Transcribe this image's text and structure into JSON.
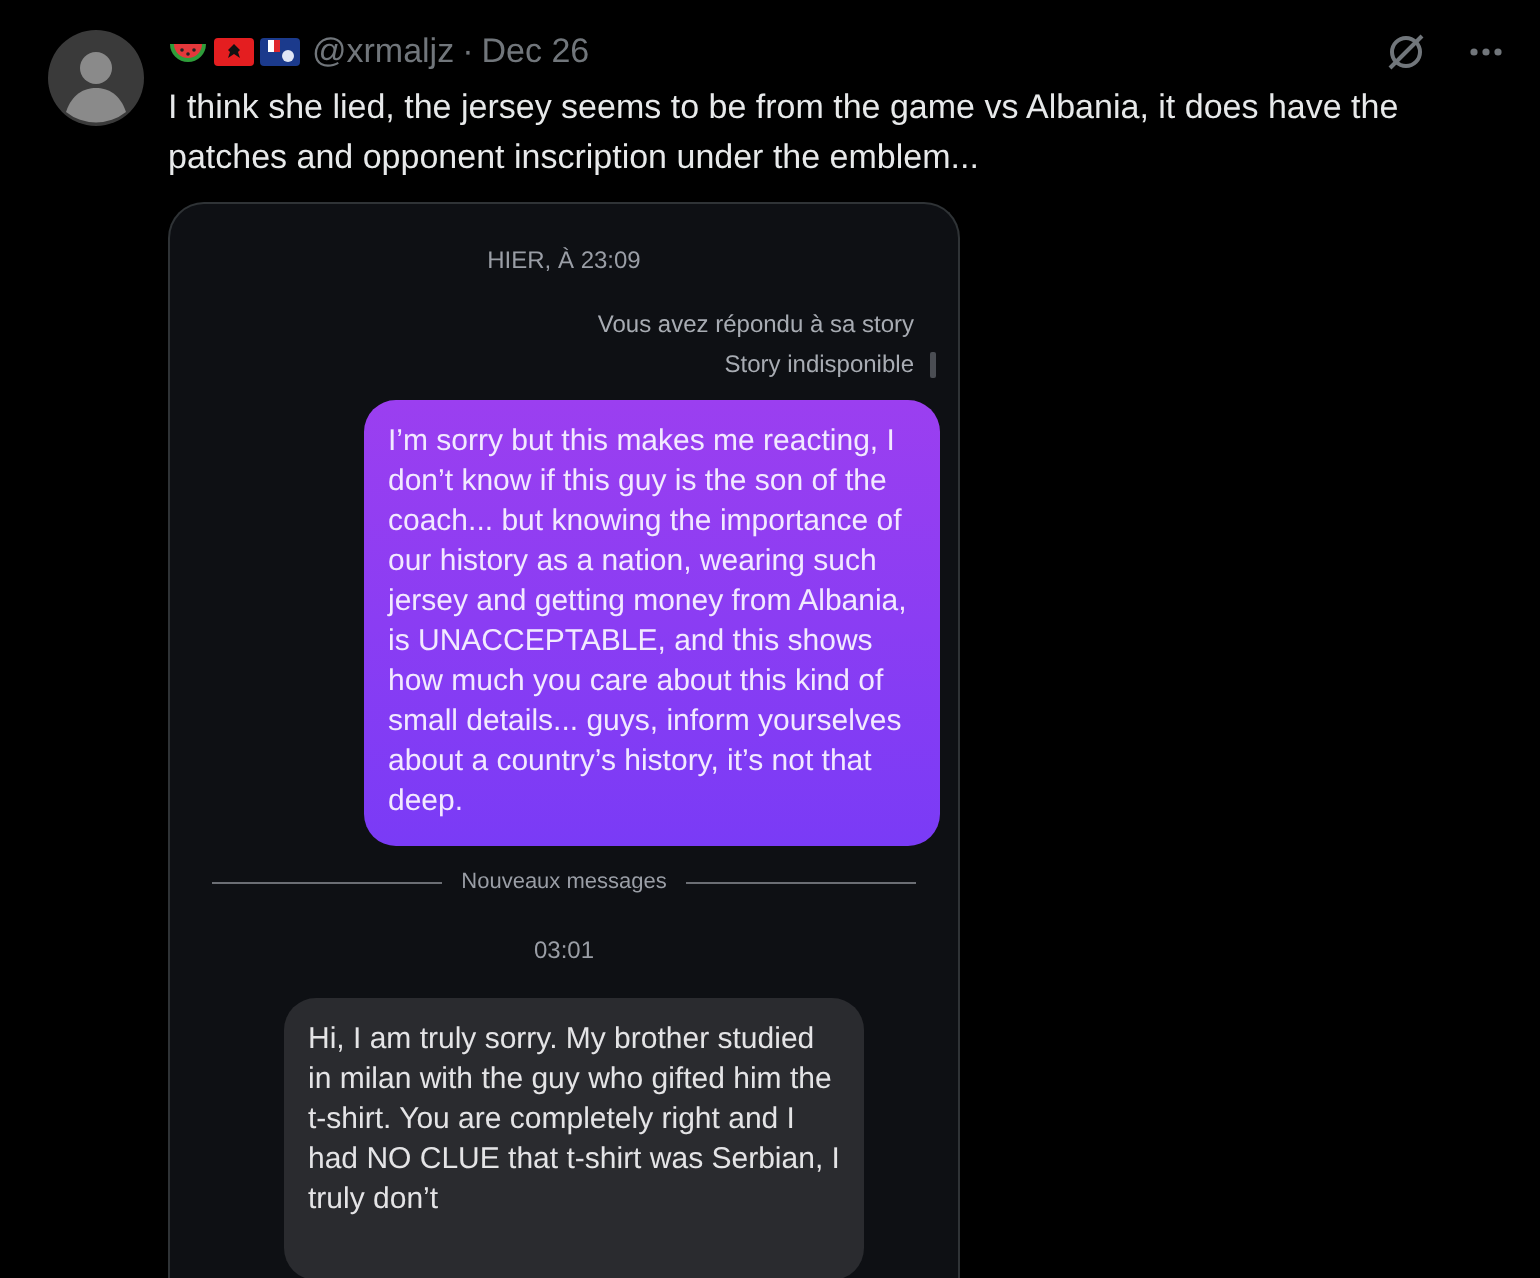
{
  "post": {
    "handle": "@xrmaljz",
    "separator": "·",
    "date": "Dec 26",
    "text": "I think she lied, the jersey seems to be from the game vs Albania, it does have the patches and opponent inscription under the emblem..."
  },
  "chat": {
    "items": [
      {
        "kind": "timestamp",
        "text": "HIER, À 23:09"
      },
      {
        "kind": "note",
        "text": "Vous avez répondu à sa story"
      },
      {
        "kind": "story-note",
        "text": "Story indisponible"
      },
      {
        "kind": "sent",
        "text": "I’m sorry but this makes me reacting, I don’t know if this guy is the son of the coach... but knowing the importance of our history as a nation, wearing such jersey and getting money from Albania, is UNACCEPTABLE, and this shows how much you care about this kind of small details... guys, inform yourselves about a country’s history, it’s not that deep."
      },
      {
        "kind": "divider",
        "text": "Nouveaux messages"
      },
      {
        "kind": "timestamp",
        "text": "03:01"
      },
      {
        "kind": "received",
        "text": "Hi, I am truly sorry. My brother studied in milan with the guy who gifted him the t-shirt. You are completely right and I had NO CLUE that t-shirt was Serbian, I truly don’t"
      }
    ]
  }
}
